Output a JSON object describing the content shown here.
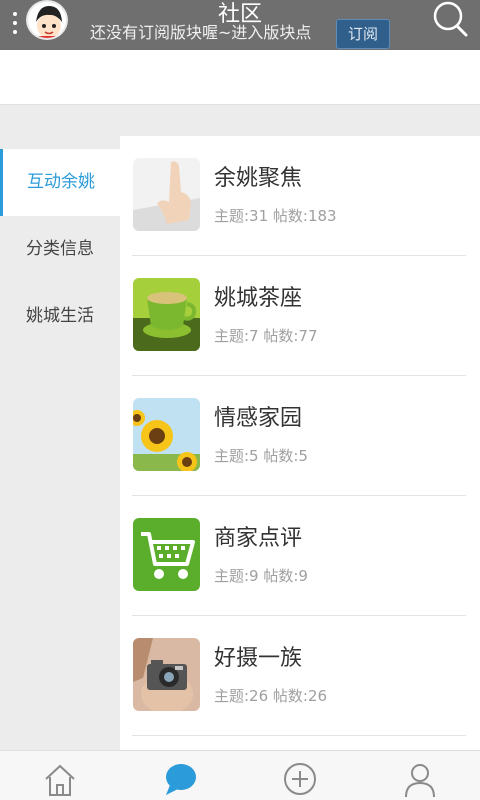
{
  "header": {
    "title": "社区",
    "hint": "还没有订阅版块喔~进入版块点",
    "subscribe_label": "订阅"
  },
  "sidebar": {
    "items": [
      {
        "label": "互动余姚",
        "active": true
      },
      {
        "label": "分类信息",
        "active": false
      },
      {
        "label": "姚城生活",
        "active": false
      }
    ]
  },
  "forums": [
    {
      "name": "余姚聚焦",
      "stats": "主题:31 帖数:183",
      "icon": "finger-touch-icon"
    },
    {
      "name": "姚城茶座",
      "stats": "主题:7 帖数:77",
      "icon": "tea-cup-icon"
    },
    {
      "name": "情感家园",
      "stats": "主题:5 帖数:5",
      "icon": "sunflower-icon"
    },
    {
      "name": "商家点评",
      "stats": "主题:9 帖数:9",
      "icon": "shopping-cart-icon"
    },
    {
      "name": "好摄一族",
      "stats": "主题:26 帖数:26",
      "icon": "camera-icon"
    }
  ],
  "bottom_nav": [
    {
      "name": "home-icon",
      "active": false
    },
    {
      "name": "chat-bubble-icon",
      "active": true
    },
    {
      "name": "add-circle-icon",
      "active": false
    },
    {
      "name": "profile-icon",
      "active": false
    }
  ],
  "colors": {
    "header_bg": "#6f6f6f",
    "accent": "#2b9bd9",
    "sidebar_bg": "#ececec",
    "subscribe_bg": "#2f5f8a"
  }
}
